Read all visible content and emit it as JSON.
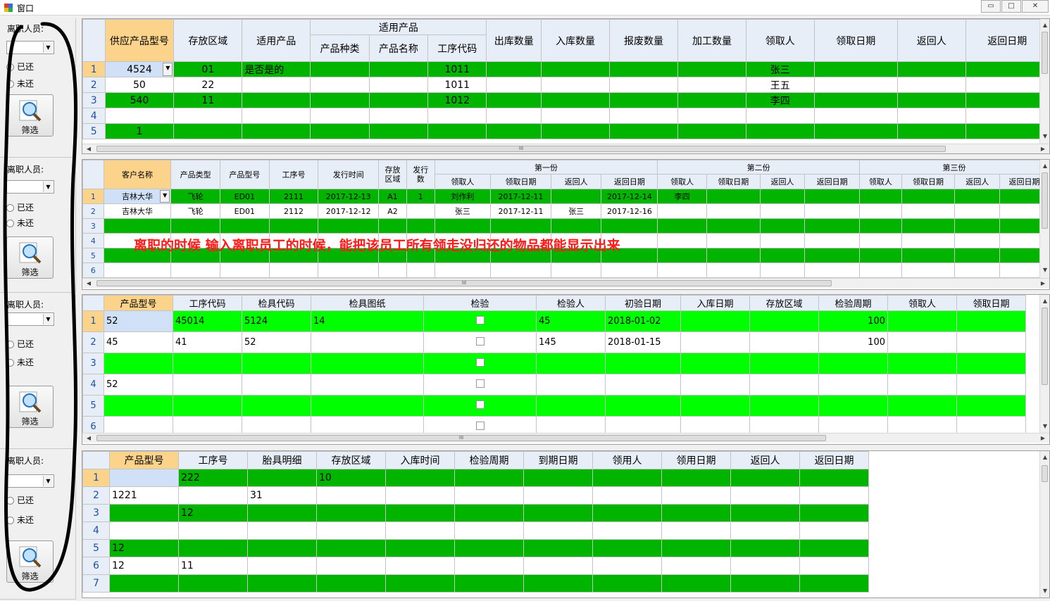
{
  "window": {
    "title": "窗口",
    "min": "▭",
    "max": "□",
    "close": "✕"
  },
  "sidebar": {
    "label": "离职人员:",
    "returned": "已还",
    "not_returned": "未还",
    "filter_button": "筛选"
  },
  "grid1": {
    "group_header": "适用产品",
    "headers": [
      "供应产品型号",
      "存放区域",
      "适用产品",
      "产品种类",
      "产品名称",
      "工序代码",
      "出库数量",
      "入库数量",
      "报废数量",
      "加工数量",
      "领取人",
      "领取日期",
      "返回人",
      "返回日期"
    ],
    "rows": [
      [
        "1",
        "4524",
        "01",
        "是否是的",
        "",
        "",
        "1011",
        "",
        "",
        "",
        "",
        "张三",
        "",
        "",
        ""
      ],
      [
        "2",
        "50",
        "22",
        "",
        "",
        "",
        "1011",
        "",
        "",
        "",
        "",
        "王五",
        "",
        "",
        ""
      ],
      [
        "3",
        "540",
        "11",
        "",
        "",
        "",
        "1012",
        "",
        "",
        "",
        "",
        "李四",
        "",
        "",
        ""
      ],
      [
        "4",
        "",
        "",
        "",
        "",
        "",
        "",
        "",
        "",
        "",
        "",
        "",
        "",
        "",
        ""
      ],
      [
        "5",
        "1",
        "",
        "",
        "",
        "",
        "",
        "",
        "",
        "",
        "",
        "",
        "",
        "",
        ""
      ]
    ]
  },
  "grid2": {
    "headers": [
      "客户名称",
      "产品类型",
      "产品型号",
      "工序号",
      "发行时间",
      "存放区域",
      "发行数"
    ],
    "groups": [
      "第一份",
      "第二份",
      "第三份"
    ],
    "subheaders": [
      "领取人",
      "领取日期",
      "返回人",
      "返回日期"
    ],
    "rows": [
      [
        "1",
        "吉林大华",
        "飞轮",
        "ED01",
        "2111",
        "2017-12-13",
        "A1",
        "1",
        "刘作利",
        "2017-12-11",
        "",
        "2017-12-14",
        "李四",
        "",
        "",
        "",
        "",
        "",
        "",
        ""
      ],
      [
        "2",
        "吉林大华",
        "飞轮",
        "ED01",
        "2112",
        "2017-12-12",
        "A2",
        "",
        "张三",
        "2017-12-11",
        "张三",
        "2017-12-16",
        "",
        "",
        "",
        "",
        "",
        "",
        "",
        ""
      ],
      [
        "3",
        "",
        "",
        "",
        "",
        "",
        "",
        "",
        "",
        "",
        "",
        "",
        "",
        "",
        "",
        "",
        "",
        "",
        "",
        ""
      ],
      [
        "4",
        "",
        "",
        "",
        "",
        "",
        "",
        "",
        "",
        "",
        "",
        "",
        "",
        "",
        "",
        "",
        "",
        "",
        "",
        ""
      ],
      [
        "5",
        "",
        "",
        "",
        "",
        "",
        "",
        "",
        "",
        "",
        "",
        "",
        "",
        "",
        "",
        "",
        "",
        "",
        "",
        ""
      ],
      [
        "6",
        "",
        "",
        "",
        "",
        "",
        "",
        "",
        "",
        "",
        "",
        "",
        "",
        "",
        "",
        "",
        "",
        "",
        "",
        ""
      ]
    ]
  },
  "grid3": {
    "headers": [
      "产品型号",
      "工序代码",
      "检具代码",
      "检具图纸",
      "检验",
      "检验人",
      "初验日期",
      "入库日期",
      "存放区域",
      "检验周期",
      "领取人",
      "领取日期"
    ],
    "rows": [
      [
        "1",
        "52",
        "45014",
        "5124",
        "14",
        "",
        "45",
        "2018-01-02",
        "",
        "",
        "100",
        "",
        ""
      ],
      [
        "2",
        "45",
        "41",
        "52",
        "",
        "",
        "145",
        "2018-01-15",
        "",
        "",
        "100",
        "",
        ""
      ],
      [
        "3",
        "",
        "",
        "",
        "",
        "",
        "",
        "",
        "",
        "",
        "",
        "",
        ""
      ],
      [
        "4",
        "52",
        "",
        "",
        "",
        "",
        "",
        "",
        "",
        "",
        "",
        "",
        ""
      ],
      [
        "5",
        "",
        "",
        "",
        "",
        "",
        "",
        "",
        "",
        "",
        "",
        "",
        ""
      ],
      [
        "6",
        "",
        "",
        "",
        "",
        "",
        "",
        "",
        "",
        "",
        "",
        "",
        ""
      ]
    ]
  },
  "grid4": {
    "headers": [
      "产品型号",
      "工序号",
      "胎具明细",
      "存放区域",
      "入库时间",
      "检验周期",
      "到期日期",
      "领用人",
      "领用日期",
      "返回人",
      "返回日期"
    ],
    "rows": [
      [
        "1",
        "",
        "222",
        "",
        "10",
        "",
        "",
        "",
        "",
        "",
        "",
        ""
      ],
      [
        "2",
        "1221",
        "",
        "31",
        "",
        "",
        "",
        "",
        "",
        "",
        "",
        ""
      ],
      [
        "3",
        "",
        "12",
        "",
        "",
        "",
        "",
        "",
        "",
        "",
        "",
        ""
      ],
      [
        "4",
        "",
        "",
        "",
        "",
        "",
        "",
        "",
        "",
        "",
        "",
        ""
      ],
      [
        "5",
        "12",
        "",
        "",
        "",
        "",
        "",
        "",
        "",
        "",
        "",
        ""
      ],
      [
        "6",
        "12",
        "11",
        "",
        "",
        "",
        "",
        "",
        "",
        "",
        "",
        ""
      ],
      [
        "7",
        "",
        "",
        "",
        "",
        "",
        "",
        "",
        "",
        "",
        "",
        ""
      ]
    ]
  },
  "annotation": "离职的时候 输入离职员工的时候，能把该员工所有领走没归还的物品都能显示出来",
  "colors": {
    "green_dark": "#00b400",
    "green_light": "#00ff00",
    "header": "#e7eef7",
    "header_selected": "#fbd38a",
    "annotation": "#ff1a1a",
    "ink": "#000000"
  }
}
